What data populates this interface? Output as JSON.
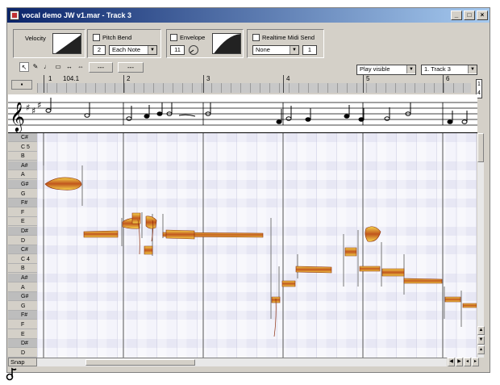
{
  "window": {
    "title": "vocal demo JW v1.mar - Track 3",
    "buttons": [
      "_",
      "□",
      "×"
    ]
  },
  "controls": {
    "velocity_label": "Velocity",
    "pitch_bend_label": "Pitch Bend",
    "pitch_bend_value": "2",
    "pitch_bend_mode": "Each Note",
    "envelope_label": "Envelope",
    "envelope_value": "11",
    "realtime_midi_label": "Realtime Midi Send",
    "realtime_midi_value": "None",
    "realtime_midi_channel": "1"
  },
  "toolbar": {
    "tools": [
      "pointer-tool",
      "pencil-tool",
      "note-tool",
      "erase-tool",
      "move-tool",
      "cut-tool"
    ],
    "btn1": "---",
    "btn2": "---",
    "play_mode": "Play visible",
    "track": "1. Track 3"
  },
  "ruler": {
    "tempo": "104.1",
    "bars": [
      "1",
      "2",
      "3",
      "4",
      "5",
      "6"
    ]
  },
  "keys": [
    "C#",
    "C 5",
    "B",
    "A#",
    "A",
    "G#",
    "G",
    "F#",
    "F",
    "E",
    "D#",
    "D",
    "C#",
    "C 4",
    "B",
    "A#",
    "A",
    "G#",
    "G",
    "F#",
    "F",
    "E",
    "D#",
    "D"
  ],
  "snap_label": "Snap",
  "colors": {
    "note_fill": "#c0561e",
    "note_highlight": "#f5d04a",
    "grid_black_row": "#e7e7f4"
  }
}
